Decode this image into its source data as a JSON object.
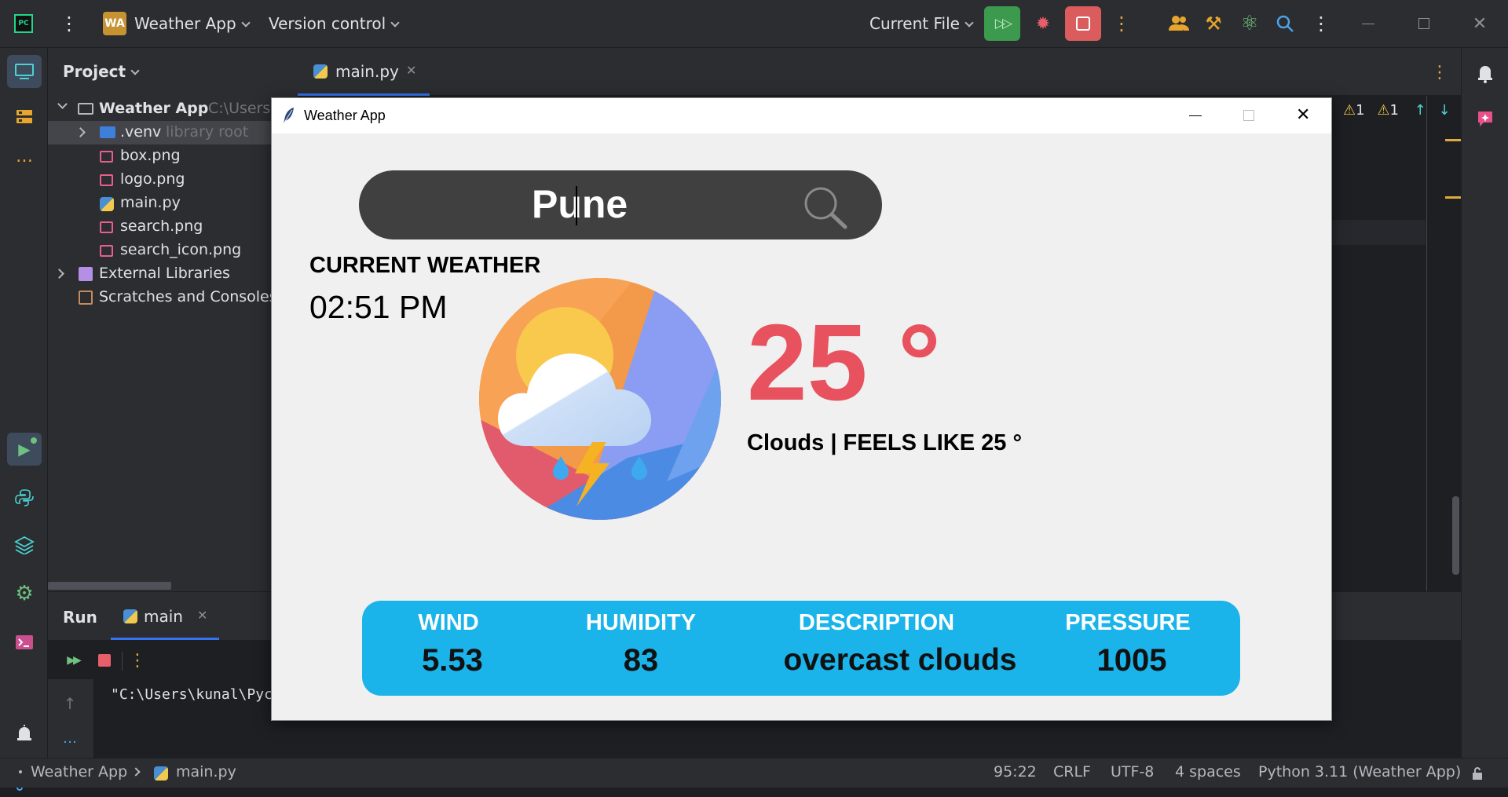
{
  "titlebar": {
    "project_badge": "WA",
    "project_name": "Weather App",
    "vcs": "Version control",
    "run_config": "Current File"
  },
  "project_panel": {
    "title": "Project",
    "tree": [
      {
        "label": "Weather App",
        "suffix": "C:\\Users",
        "icon": "folder-icon"
      },
      {
        "label": ".venv",
        "suffix": "library root",
        "icon": "venv-folder-icon"
      },
      {
        "label": "box.png",
        "icon": "image-file-icon"
      },
      {
        "label": "logo.png",
        "icon": "image-file-icon"
      },
      {
        "label": "main.py",
        "icon": "python-file-icon"
      },
      {
        "label": "search.png",
        "icon": "image-file-icon"
      },
      {
        "label": "search_icon.png",
        "icon": "image-file-icon"
      },
      {
        "label": "External Libraries",
        "icon": "library-icon"
      },
      {
        "label": "Scratches and Consoles",
        "icon": "scratches-icon"
      }
    ]
  },
  "editor": {
    "tab": "main.py",
    "warnings_a": "1",
    "warnings_b": "1"
  },
  "run_panel": {
    "title": "Run",
    "tab": "main",
    "console_line": "\"C:\\Users\\kunal\\Pyc"
  },
  "statusbar": {
    "breadcrumb_project": "Weather App",
    "breadcrumb_file": "main.py",
    "position": "95:22",
    "line_sep": "CRLF",
    "encoding": "UTF-8",
    "indent": "4 spaces",
    "interpreter": "Python 3.11 (Weather App)"
  },
  "weather_window": {
    "title": "Weather App",
    "search_value": "Pune",
    "current_weather_label": "CURRENT WEATHER",
    "time": "02:51 PM",
    "temperature": "25 °",
    "condition": "Clouds | FEELS LIKE 25 °",
    "info": {
      "wind_label": "WIND",
      "wind_value": "5.53",
      "humidity_label": "HUMIDITY",
      "humidity_value": "83",
      "description_label": "DESCRIPTION",
      "description_value": "overcast clouds",
      "pressure_label": "PRESSURE",
      "pressure_value": "1005"
    }
  },
  "colors": {
    "ide_bg": "#2b2d30",
    "editor_bg": "#1e1f22",
    "run_green": "#3c9a4e",
    "stop_red": "#db5c5c",
    "temp_red": "#e8525f",
    "info_blue": "#1ab3ea"
  }
}
